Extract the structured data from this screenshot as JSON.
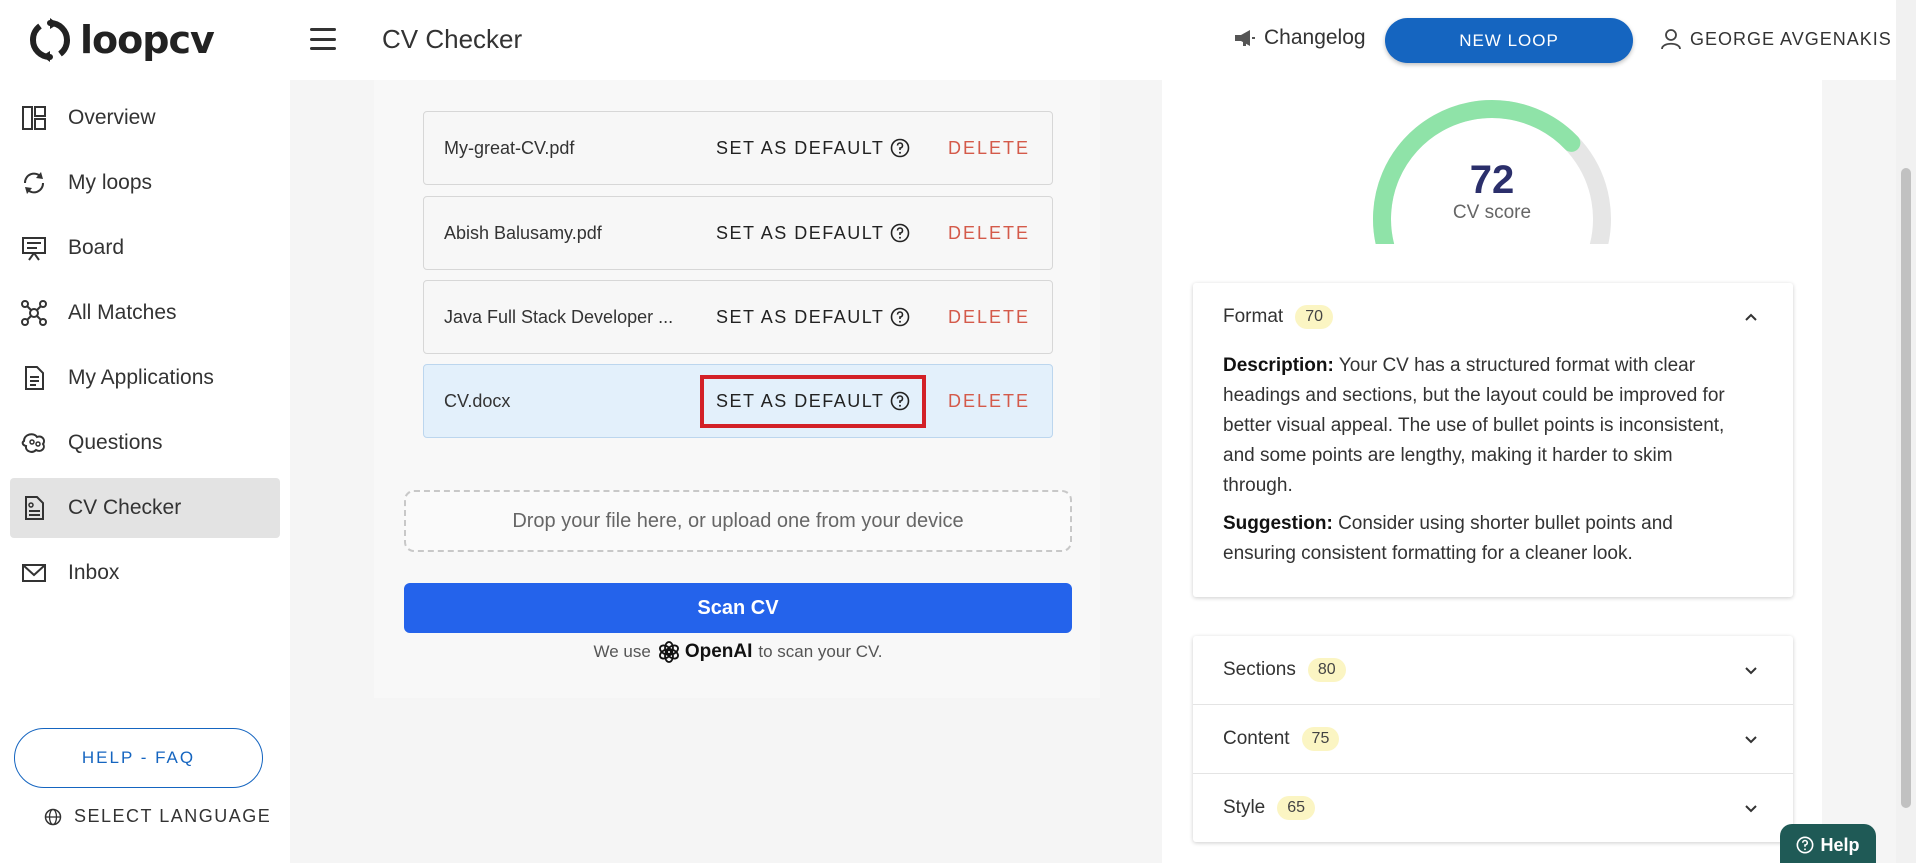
{
  "header": {
    "logo_text": "loopcv",
    "page_title": "CV Checker",
    "changelog_label": "Changelog",
    "new_loop_label": "NEW LOOP",
    "user_name": "GEORGE AVGENAKIS"
  },
  "sidebar": {
    "items": [
      {
        "label": "Overview",
        "icon": "overview-icon"
      },
      {
        "label": "My loops",
        "icon": "loop-icon"
      },
      {
        "label": "Board",
        "icon": "board-icon"
      },
      {
        "label": "All Matches",
        "icon": "network-icon"
      },
      {
        "label": "My Applications",
        "icon": "document-icon"
      },
      {
        "label": "Questions",
        "icon": "questions-icon"
      },
      {
        "label": "CV Checker",
        "icon": "cv-icon",
        "active": true
      },
      {
        "label": "Inbox",
        "icon": "mail-icon"
      }
    ],
    "help_faq": "HELP - FAQ",
    "select_language": "SELECT LANGUAGE"
  },
  "files": [
    {
      "name": "My-great-CV.pdf",
      "set_default": "SET AS DEFAULT",
      "delete": "DELETE"
    },
    {
      "name": "Abish Balusamy.pdf",
      "set_default": "SET AS DEFAULT",
      "delete": "DELETE"
    },
    {
      "name": "Java Full Stack Developer ...",
      "set_default": "SET AS DEFAULT",
      "delete": "DELETE"
    },
    {
      "name": "CV.docx",
      "set_default": "SET AS DEFAULT",
      "delete": "DELETE",
      "selected": true
    }
  ],
  "upload": {
    "dropzone_text": "Drop your file here, or upload one from your device",
    "scan_label": "Scan CV",
    "note_prefix": "We use",
    "note_brand": "OpenAI",
    "note_suffix": "to scan your CV."
  },
  "score": {
    "value": "72",
    "label": "CV score",
    "fraction": 0.72,
    "colors": {
      "fill": "#8fe3a8",
      "track": "#e6e6e6",
      "number": "#2b2f6b"
    }
  },
  "sections": [
    {
      "title": "Format",
      "score": "70",
      "expanded": true,
      "description_label": "Description:",
      "description": "Your CV has a structured format with clear headings and sections, but the layout could be improved for better visual appeal. The use of bullet points is inconsistent, and some points are lengthy, making it harder to skim through.",
      "suggestion_label": "Suggestion:",
      "suggestion": "Consider using shorter bullet points and ensuring consistent formatting for a cleaner look."
    },
    {
      "title": "Sections",
      "score": "80",
      "expanded": false
    },
    {
      "title": "Content",
      "score": "75",
      "expanded": false
    },
    {
      "title": "Style",
      "score": "65",
      "expanded": false
    }
  ],
  "help_widget": {
    "label": "Help"
  },
  "colors": {
    "primary": "#1565c0",
    "scan_button": "#2463eb",
    "delete": "#d45a4a",
    "highlight": "#d32027",
    "badge": "#fbf5c3"
  }
}
